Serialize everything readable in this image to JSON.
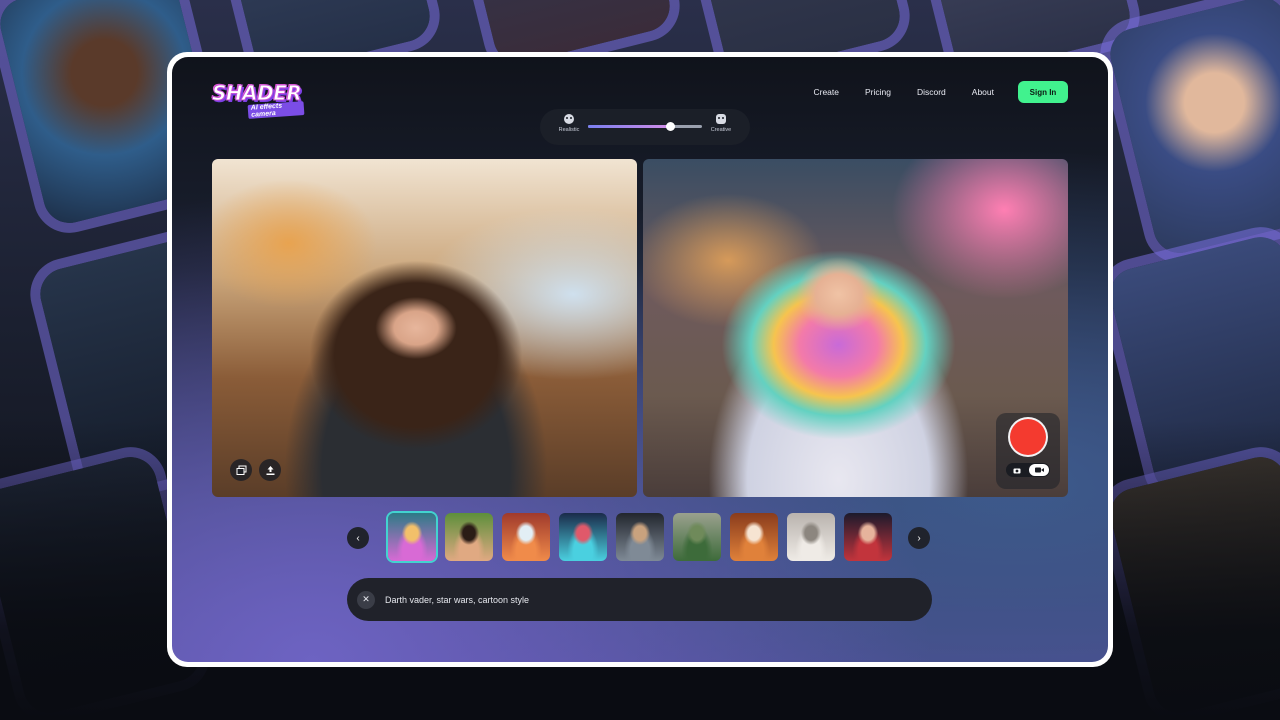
{
  "brand": {
    "logo_text": "SHADER",
    "logo_subtext": "AI effects camera"
  },
  "nav": {
    "links": [
      "Create",
      "Pricing",
      "Discord",
      "About"
    ],
    "sign_in_label": "Sign In",
    "sign_in_color": "#41f28e"
  },
  "style_slider": {
    "left_label": "Realistic",
    "right_label": "Creative",
    "left_icon": "realistic-face-icon",
    "right_icon": "creative-face-icon",
    "value": 0.72
  },
  "video": {
    "left_controls": [
      "gallery-icon",
      "upload-icon"
    ],
    "record_color": "#f43a2f",
    "capture_modes": [
      "photo",
      "video"
    ],
    "active_mode": "video"
  },
  "carousel": {
    "selected_index": 0,
    "style_thumbnails": [
      {
        "name": "rainbow-hair",
        "colors": [
          "#2d7b86",
          "#d86ad5",
          "#f2c06a"
        ]
      },
      {
        "name": "warm-portrait",
        "colors": [
          "#5d8f3b",
          "#e0a982",
          "#2b1c16"
        ]
      },
      {
        "name": "superhero",
        "colors": [
          "#a03a2c",
          "#f08b4a",
          "#e2eef5"
        ]
      },
      {
        "name": "cyberpunk",
        "colors": [
          "#1a2b4a",
          "#4ad0e0",
          "#e0596a"
        ]
      },
      {
        "name": "sci-fi-pilot",
        "colors": [
          "#22262e",
          "#7f8a96",
          "#c9a27e"
        ]
      },
      {
        "name": "green-monster",
        "colors": [
          "#9aa18e",
          "#3d6b3a",
          "#6f8a5a"
        ]
      },
      {
        "name": "fox-character",
        "colors": [
          "#8a3c1c",
          "#e0813a",
          "#f6e4d2"
        ]
      },
      {
        "name": "marble-statue",
        "colors": [
          "#b9b3ae",
          "#efebe6",
          "#8c867f"
        ]
      },
      {
        "name": "red-heroine",
        "colors": [
          "#1c1a2c",
          "#c2343c",
          "#e6b39c"
        ]
      }
    ]
  },
  "prompt": {
    "text": "Darth vader, star wars, cartoon style"
  }
}
